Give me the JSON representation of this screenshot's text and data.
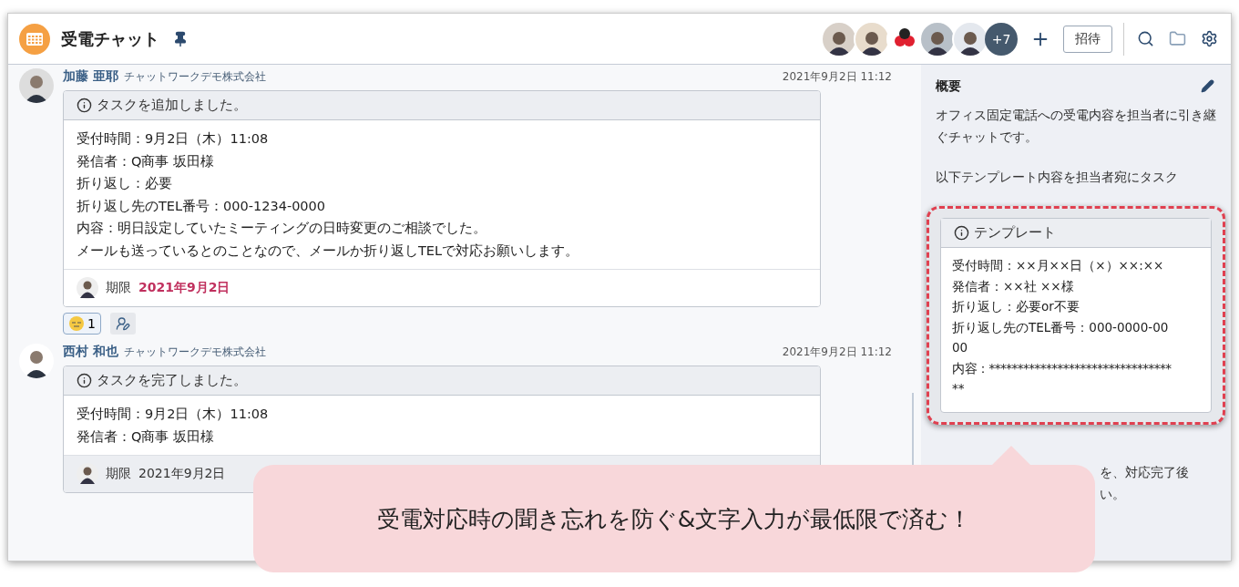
{
  "room": {
    "title": "受電チャット",
    "pinned": true,
    "members": [
      {
        "kind": "photo"
      },
      {
        "kind": "photo"
      },
      {
        "kind": "logo"
      },
      {
        "kind": "photo"
      },
      {
        "kind": "photo"
      }
    ],
    "more_members": "+7",
    "invite_button": "招待"
  },
  "messages": [
    {
      "author": "加藤 亜耶",
      "company": "チャットワークデモ株式会社",
      "time": "2021年9月2日 11:12",
      "task_header": "タスクを追加しました。",
      "lines": [
        "受付時間：9月2日（木）11:08",
        "発信者：Q商事 坂田様",
        "折り返し：必要",
        "折り返し先のTEL番号：000-1234-0000",
        "内容：明日設定していたミーティングの日時変更のご相談でした。",
        "メールも送っているとのことなので、メールか折り返しTELで対応お願いします。"
      ],
      "deadline_label": "期限",
      "deadline": "2021年9月2日",
      "deadline_highlight": true,
      "reaction_count": "1"
    },
    {
      "author": "西村 和也",
      "company": "チャットワークデモ株式会社",
      "time": "2021年9月2日 11:12",
      "task_header": "タスクを完了しました。",
      "lines": [
        "受付時間：9月2日（木）11:08",
        "発信者：Q商事 坂田様"
      ],
      "deadline_label": "期限",
      "deadline": "2021年9月2日",
      "deadline_highlight": false
    }
  ],
  "summary": {
    "title": "概要",
    "paragraphs": [
      "オフィス固定電話への受電内容を担当者に引き継ぐチャットです。",
      "以下テンプレート内容を担当者宛にタスク"
    ],
    "template_title": "テンプレート",
    "template_lines": [
      "受付時間：××月××日（×）××:××",
      "発信者：××社 ××様",
      "折り返し：必要or不要",
      "折り返し先のTEL番号：000-0000-00",
      "00",
      "内容：********************************",
      "**"
    ],
    "tail_lines": [
      "を、対応完了後",
      "い。"
    ]
  },
  "callout": "受電対応時の聞き忘れを防ぐ&文字入力が最低限で済む！"
}
